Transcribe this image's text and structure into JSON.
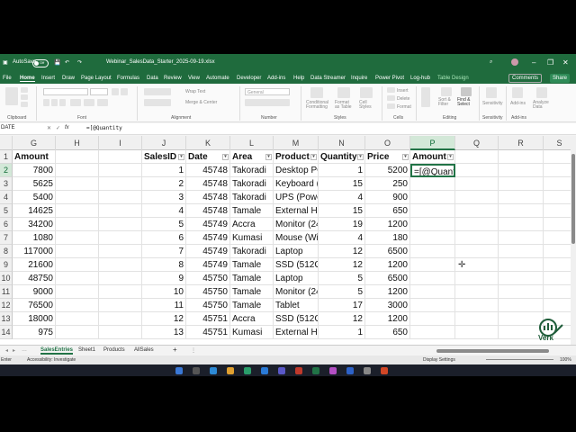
{
  "titlebar": {
    "autosave": "AutoSave",
    "toggle": "Off",
    "filename": "Webinar_SalesData_Starter_2025-09-19.xlsx"
  },
  "menu": [
    "File",
    "Home",
    "Insert",
    "Draw",
    "Page Layout",
    "Formulas",
    "Data",
    "Review",
    "View",
    "Automate",
    "Developer",
    "Add-ins",
    "Help",
    "Data Streamer",
    "Inquire",
    "Power Pivot",
    "Log-hub",
    "Table Design"
  ],
  "comments_label": "Comments",
  "share_label": "Share",
  "ribbon": {
    "groups": [
      "Clipboard",
      "Font",
      "Alignment",
      "Number",
      "Styles",
      "Cells",
      "Editing",
      "Sensitivity",
      "Add-ins"
    ],
    "wrap_text": "Wrap Text",
    "merge": "Merge & Center",
    "number_format": "General",
    "styles_items": [
      "Conditional Formatting",
      "Format as Table",
      "Cell Styles"
    ],
    "cells_items": [
      "Insert",
      "Delete",
      "Format"
    ],
    "editing_items": [
      "Sort & Filter",
      "Find & Select"
    ],
    "sensitivity": "Sensitivity",
    "addins": "Add-ins",
    "analyze": "Analyze Data"
  },
  "formula_bar": {
    "namebox": "DATE",
    "formula": "=[@Quantity"
  },
  "columns": [
    "G",
    "H",
    "I",
    "J",
    "K",
    "L",
    "M",
    "N",
    "O",
    "P",
    "Q",
    "R",
    "S"
  ],
  "rows": [
    "1",
    "2",
    "3",
    "4",
    "5",
    "6",
    "7",
    "8",
    "9",
    "10",
    "11",
    "12",
    "13",
    "14"
  ],
  "headers": {
    "amount_g": "Amount",
    "salesid": "SalesID",
    "date": "Date",
    "area": "Area",
    "product": "Product",
    "quantity": "Quantity",
    "price": "Price",
    "amount_p": "Amount"
  },
  "table": [
    {
      "g": "7800",
      "j": "1",
      "k": "45748",
      "l": "Takoradi",
      "m": "Desktop PC",
      "n": "1",
      "o": "5200"
    },
    {
      "g": "5625",
      "j": "2",
      "k": "45748",
      "l": "Takoradi",
      "m": "Keyboard (W",
      "n": "15",
      "o": "250"
    },
    {
      "g": "5400",
      "j": "3",
      "k": "45748",
      "l": "Takoradi",
      "m": "UPS (Power",
      "n": "4",
      "o": "900"
    },
    {
      "g": "14625",
      "j": "4",
      "k": "45748",
      "l": "Tamale",
      "m": "External HD",
      "n": "15",
      "o": "650"
    },
    {
      "g": "34200",
      "j": "5",
      "k": "45749",
      "l": "Accra",
      "m": "Monitor (24",
      "n": "19",
      "o": "1200"
    },
    {
      "g": "1080",
      "j": "6",
      "k": "45749",
      "l": "Kumasi",
      "m": "Mouse (Wir",
      "n": "4",
      "o": "180"
    },
    {
      "g": "117000",
      "j": "7",
      "k": "45749",
      "l": "Takoradi",
      "m": "Laptop",
      "n": "12",
      "o": "6500"
    },
    {
      "g": "21600",
      "j": "8",
      "k": "45749",
      "l": "Tamale",
      "m": "SSD (512GE",
      "n": "12",
      "o": "1200"
    },
    {
      "g": "48750",
      "j": "9",
      "k": "45750",
      "l": "Tamale",
      "m": "Laptop",
      "n": "5",
      "o": "6500"
    },
    {
      "g": "9000",
      "j": "10",
      "k": "45750",
      "l": "Tamale",
      "m": "Monitor (24",
      "n": "5",
      "o": "1200"
    },
    {
      "g": "76500",
      "j": "11",
      "k": "45750",
      "l": "Tamale",
      "m": "Tablet",
      "n": "17",
      "o": "3000"
    },
    {
      "g": "18000",
      "j": "12",
      "k": "45751",
      "l": "Accra",
      "m": "SSD (512GE",
      "n": "12",
      "o": "1200"
    },
    {
      "g": "975",
      "j": "13",
      "k": "45751",
      "l": "Kumasi",
      "m": "External HD",
      "n": "1",
      "o": "650"
    }
  ],
  "active_cell_text": "=[@Quantity",
  "sheets": [
    "SalesEntries",
    "Sheet1",
    "Products",
    "AllSales"
  ],
  "add_sheet": "+",
  "status": {
    "mode": "Enter",
    "accessibility": "Accessibility: Investigate",
    "display": "Display Settings",
    "zoom": "100%"
  },
  "logo_text": "Verk",
  "colors": {
    "excel_green": "#1f6b3d",
    "selection": "#217346"
  }
}
